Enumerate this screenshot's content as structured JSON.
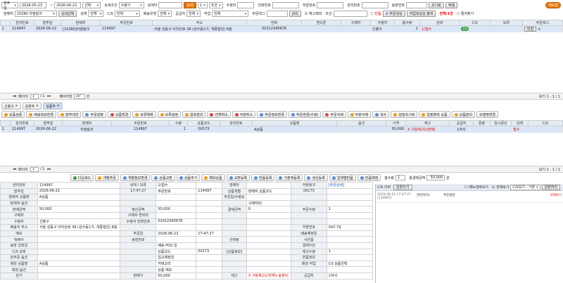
{
  "search": {
    "date_type": "발주일",
    "date_from": "2026-05-23",
    "date_to": "2026-06-22",
    "period": "선택",
    "detail_cond_label": "상세조건",
    "detail_cond": "수량가",
    "detail_value_label": "검색어",
    "search_button": "검색",
    "cond1": "1",
    "cond1b": "조건",
    "qty_label": "수정자",
    "tel_label": "전화번호",
    "order_no_label": "주문번호",
    "mgmt_no_label": "관리번호",
    "invoice_label": "송장번호",
    "reset_button": "초기화",
    "excel_button": "엑셀",
    "menu_button": "메뉴얼",
    "seller_label": "판매처",
    "seller_value": "10280 아컴링크",
    "seller_detail": "상세선택",
    "status_label": "상태",
    "status_value": "전체",
    "cs_label": "C/S",
    "cs_value": "전체",
    "delivery_label": "배송유형",
    "delivery_value": "전체",
    "supplier_label": "공급처",
    "supplier_value": "전체",
    "work_label": "작업",
    "work_value": "전체",
    "order_tag_label": "주문태그",
    "order_tag_btn": "관리",
    "except_stock_label": "재고제외",
    "cond2": "조건",
    "return_label": "반품",
    "order_create_button": "주문생성",
    "work_status_button": "작업대상상 출력",
    "count_text": "전체:1건",
    "bookmark_label": "즐겨찾기"
  },
  "top_grid": {
    "headers": [
      "관리번호",
      "발주일",
      "판매처",
      "주문번호",
      "주소",
      "전화",
      "핸드폰",
      "구매처",
      "수량자",
      "총수량",
      "상태",
      "C/S",
      "보류",
      "주문태그"
    ],
    "rows": [
      {
        "num": "1",
        "mgmt": "114997",
        "date": "2026-06-22",
        "seller": "[10280]아컴링크",
        "order_no": "114997",
        "addr": "서울 성동구 아차산로 38 (성수동1가, 개풍빌딩) 8층",
        "tel": "01012345678",
        "hp": "",
        "buyer": "",
        "qty_person": "신평구",
        "total": "1",
        "status": "1/접수",
        "cs": "정상",
        "hold": "",
        "tag": "미전"
      }
    ]
  },
  "pager1": {
    "page_label": "페이지",
    "page": "1",
    "of": "/ 1",
    "size_label": "페이지당",
    "size": "20",
    "unit": "건",
    "info": "보기 1 - 1 / 1"
  },
  "tabs": [
    "신평구",
    "원본주",
    "상품주"
  ],
  "toolbar": [
    "상품검증",
    "배송정보변경",
    "발주대전",
    "주문합병",
    "상품변경",
    "보류해제",
    "보류설정",
    "합포분리",
    "전체취소",
    "부분취소",
    "주문정보변경",
    "주문변경(수정)",
    "주문삭제",
    "부분삭제",
    "회수",
    "설정초기화",
    "일괄출력 상품",
    "상품분리",
    "모델명변경"
  ],
  "mid_grid": {
    "headers": [
      "관리번호",
      "발주일",
      "판매처",
      "주문번호",
      "수량",
      "상품코드",
      "관리번호",
      "상품명",
      "옵션",
      "가격",
      "재고",
      "공급처",
      "중량",
      "일시중단",
      "상태",
      "C/S"
    ],
    "rows": [
      {
        "num": "1",
        "mgmt": "114997",
        "date": "2026-06-22",
        "seller": "아컴링크",
        "order_no": "114997",
        "qty": "1",
        "code": "00173",
        "mgmt2": "",
        "name": "A상품",
        "option": "",
        "price": "50,000",
        "stock": "X 가용재고1(현재)",
        "supplier": "1자사",
        "weight": "",
        "pause": "",
        "status": "접수",
        "cs": ""
      }
    ]
  },
  "pager2": {
    "page_label": "페이지",
    "page": "1",
    "of": "/ 1",
    "info": "보기 1 - 1 / 1"
  },
  "bottom_toolbar": [
    "다운로드",
    "개별주문",
    "개별정보변경",
    "상품교환",
    "상품추가",
    "해외상품",
    "교환등록",
    "반품등록",
    "가출재등록",
    "생산등록",
    "업체별반품",
    "반품예정"
  ],
  "total_qty_label": "총수량",
  "total_qty": "1",
  "total_price_label": "총결제금액",
  "total_price": "50,000",
  "won": "원",
  "detail": {
    "rows": [
      [
        "관리번호",
        "114997",
        "상태 / 보류",
        "1/접수",
        "",
        "판매처",
        "",
        "아컴링크",
        "[주문상세]"
      ],
      [
        "발주일",
        "2026-06-22",
        "17:47:27",
        "주문번호",
        "114997",
        "상품개별",
        "판매처 상품코드",
        "00173",
        ""
      ],
      [
        "판매처 상품명",
        "A상품",
        "",
        "",
        "",
        "주문일/수령요",
        "",
        "",
        ""
      ],
      [
        "판매처 옵션",
        "",
        "",
        "",
        "",
        "",
        "구매자ID",
        "",
        ""
      ],
      [
        "판매금액",
        "50,000",
        "정산금액",
        "50,000",
        "",
        "결제금액",
        "0",
        "주문수량",
        "1"
      ],
      [
        "구매자",
        "",
        "구매자 연락처",
        "",
        "",
        "",
        "",
        "",
        ""
      ],
      [
        "수령자",
        "신평구",
        "수령자 전화번호",
        "01012345678",
        "",
        "",
        "",
        "",
        ""
      ],
      [
        "배송지 주소",
        "서울 성동구 아차산로 38 (성수동1가, 개풍빌딩) 8층",
        "",
        "",
        "",
        "",
        "",
        "우편번호",
        "047-79"
      ],
      [
        "메모",
        "",
        "주문일",
        "2026-06-22",
        "17:47:27",
        "",
        "",
        "배송예정일",
        ""
      ],
      [
        "택배사",
        "",
        "송장번호",
        "",
        "",
        "선택됨",
        "",
        "사은품",
        ""
      ],
      [
        "송장 입력일",
        "",
        "",
        "배송 POS 일",
        "",
        "",
        "",
        "결제수단",
        ""
      ],
      [
        "C/S 상태",
        "",
        "",
        "상품코드",
        "00173",
        "[상품정보]",
        "",
        "재고수량",
        "1"
      ],
      [
        "원주문 옵션",
        "",
        "",
        "입고예정일",
        "",
        "",
        "",
        "반품정보",
        ""
      ],
      [
        "매칭 상품명",
        "A상품",
        "",
        "카테고리",
        "",
        "",
        "",
        "매칭 작업",
        "CS 상품선택"
      ],
      [
        "매칭 옵션",
        "",
        "",
        "상품 메모",
        "",
        "",
        "",
        "",
        ""
      ],
      [
        "원가",
        "",
        "판매가",
        "50,000",
        "",
        "재고",
        "X 가용재고1(현재1-송장0)",
        "공급처",
        "1자사"
      ]
    ]
  },
  "cs_panel": {
    "title": "C/S 이력",
    "btn_add": "답장쓰기",
    "check1": "메뉴넘버보기",
    "check2": "전체보기",
    "btn_type": "C/S보기 - 기본",
    "btn_reg": "원본처리",
    "entry_date": "2026-06-22 17:47:27",
    "entry_user": "관리자74",
    "entry_text": "주문생성",
    "entry_id": "(114997)",
    "entry_del": "삭제하기"
  },
  "colors": {
    "accent": "#e8760e",
    "header": "#e6ebf2",
    "selected": "#dbe6f7"
  }
}
